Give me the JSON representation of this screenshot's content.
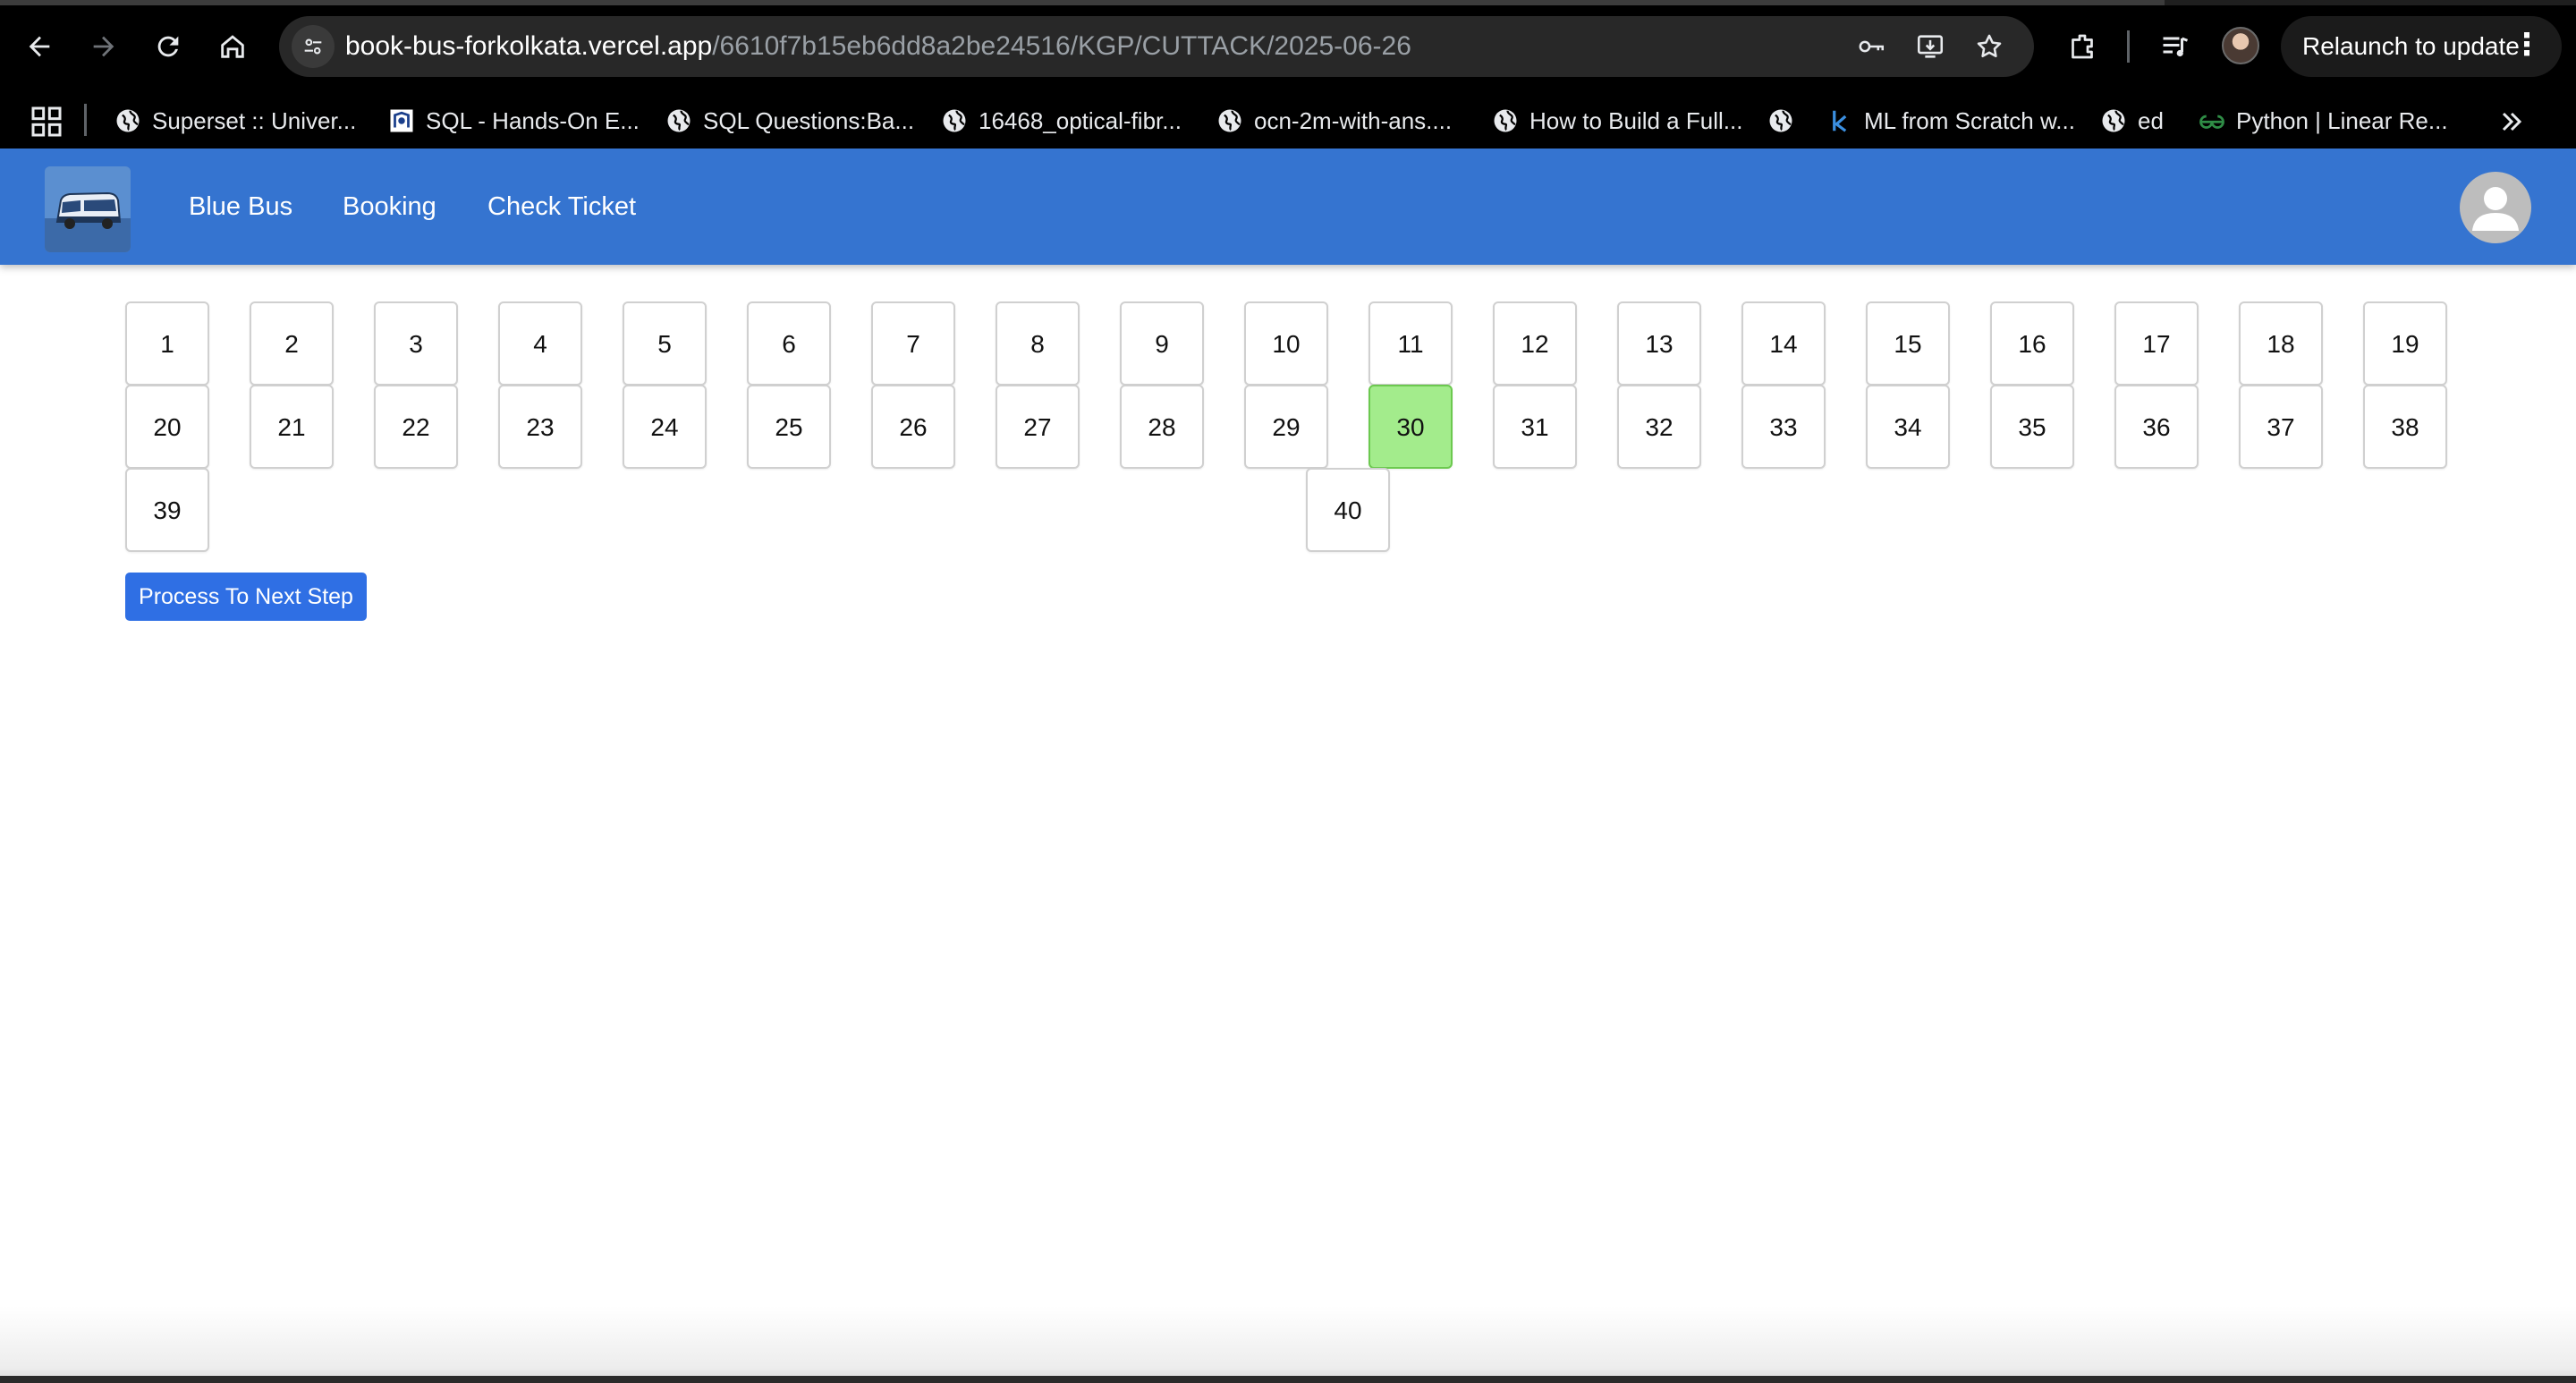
{
  "browser": {
    "url_host": "book-bus-forkolkata.vercel.app",
    "url_path": "/6610f7b15eb6dd8a2be24516/KGP/CUTTACK/2025-06-26",
    "relaunch_label": "Relaunch to update",
    "bookmarks": [
      {
        "label": "Superset :: Univer...",
        "icon": "globe-icon"
      },
      {
        "label": "SQL - Hands-On E...",
        "icon": "site-icon"
      },
      {
        "label": "SQL Questions:Ba...",
        "icon": "globe-icon"
      },
      {
        "label": "16468_optical-fibr...",
        "icon": "globe-icon"
      },
      {
        "label": "ocn-2m-with-ans....",
        "icon": "globe-icon"
      },
      {
        "label": "How to Build a Full...",
        "icon": "globe-icon"
      },
      {
        "label": "",
        "icon": "globe-icon"
      },
      {
        "label": "ML from Scratch w...",
        "icon": "k-icon"
      },
      {
        "label": "ed",
        "icon": "globe-icon"
      },
      {
        "label": "Python | Linear Re...",
        "icon": "gfg-icon"
      }
    ]
  },
  "header": {
    "brand": "Blue Bus",
    "nav": [
      "Booking",
      "Check Ticket"
    ]
  },
  "seats": {
    "labels": [
      "1",
      "2",
      "3",
      "4",
      "5",
      "6",
      "7",
      "8",
      "9",
      "10",
      "11",
      "12",
      "13",
      "14",
      "15",
      "16",
      "17",
      "18",
      "19",
      "20",
      "21",
      "22",
      "23",
      "24",
      "25",
      "26",
      "27",
      "28",
      "29",
      "30",
      "31",
      "32",
      "33",
      "34",
      "35",
      "36",
      "37",
      "38",
      "39",
      "40"
    ],
    "selected": "30"
  },
  "actions": {
    "next_label": "Process To Next Step"
  },
  "colors": {
    "header_bg": "#3574d0",
    "selected_seat": "#a3ec8c",
    "primary_button": "#2f6fe4"
  }
}
